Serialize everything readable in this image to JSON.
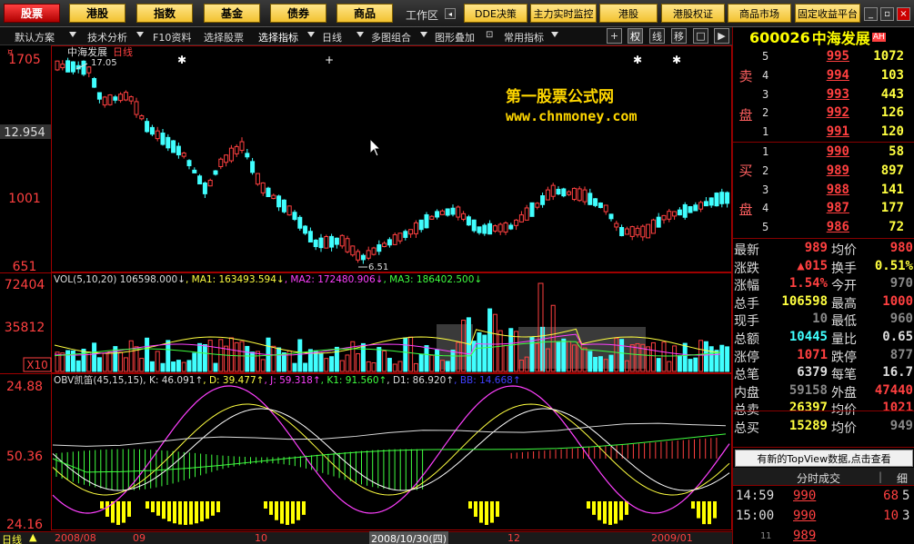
{
  "topbar": {
    "buttons": [
      "股票",
      "港股",
      "指数",
      "基金",
      "债券",
      "商品"
    ],
    "workzone": "工作区",
    "tabs": [
      "DDE决策",
      "主力实时监控",
      "港股",
      "港股权证",
      "商品市场",
      "固定收益平台"
    ]
  },
  "toolbar": {
    "items": [
      "默认方案",
      "技术分析",
      "F10资料",
      "选择股票",
      "选择指标",
      "日线",
      "多图组合",
      "图形叠加",
      "常用指标"
    ],
    "icons": [
      "+",
      "权",
      "线",
      "移",
      "□",
      "▶"
    ]
  },
  "stock": {
    "code": "600026",
    "name": "中海发展",
    "tag": "AH"
  },
  "watermark": {
    "line1": "第一股票公式网",
    "line2": "www.chnmoney.com"
  },
  "main_panel": {
    "title_name": "中海发展",
    "title_period": "日线",
    "price_labels": [
      "1705",
      "12.954",
      "1001",
      "651"
    ],
    "high_note": "17.05",
    "low_note": "6.51"
  },
  "vol_panel": {
    "header": [
      {
        "t": "VOL(5,10,20) 106598.000↓",
        "c": "#ddd"
      },
      {
        "t": "MA1: 163493.594↓",
        "c": "#ffff40"
      },
      {
        "t": "MA2: 172480.906↓",
        "c": "#ff40ff"
      },
      {
        "t": "MA3: 186402.500↓",
        "c": "#40ff40"
      }
    ],
    "labels": [
      "72404",
      "35812",
      "X10"
    ]
  },
  "ind_panel": {
    "header": [
      {
        "t": "OBV凯笛(45,15,15)",
        "c": "#ddd"
      },
      {
        "t": "K: 46.091↑",
        "c": "#ddd"
      },
      {
        "t": "D: 39.477↑",
        "c": "#ffff40"
      },
      {
        "t": "J: 59.318↑",
        "c": "#ff40ff"
      },
      {
        "t": "K1: 91.560↑",
        "c": "#40ff40"
      },
      {
        "t": "D1: 86.920↑",
        "c": "#ddd"
      },
      {
        "t": "BB: 14.668↑",
        "c": "#4040ff"
      }
    ],
    "labels": [
      "24.88",
      "50.36",
      "24.16"
    ]
  },
  "date_axis": {
    "labels": [
      "2008/08",
      "09",
      "10",
      "2008/10/30(四)",
      "12",
      "2009/01"
    ]
  },
  "bottom": {
    "period": "日线"
  },
  "orderbook": {
    "sell_label": [
      "卖",
      "盘"
    ],
    "buy_label": [
      "买",
      "盘"
    ],
    "sell": [
      {
        "lv": "5",
        "px": "995",
        "vol": "1072"
      },
      {
        "lv": "4",
        "px": "994",
        "vol": "103"
      },
      {
        "lv": "3",
        "px": "993",
        "vol": "443"
      },
      {
        "lv": "2",
        "px": "992",
        "vol": "126"
      },
      {
        "lv": "1",
        "px": "991",
        "vol": "120"
      }
    ],
    "buy": [
      {
        "lv": "1",
        "px": "990",
        "vol": "58"
      },
      {
        "lv": "2",
        "px": "989",
        "vol": "897"
      },
      {
        "lv": "3",
        "px": "988",
        "vol": "141"
      },
      {
        "lv": "4",
        "px": "987",
        "vol": "177"
      },
      {
        "lv": "5",
        "px": "986",
        "vol": "72"
      }
    ]
  },
  "stats": [
    {
      "k1": "最新",
      "v1": "989",
      "c1": "c-red",
      "k2": "均价",
      "v2": "980",
      "c2": "c-red"
    },
    {
      "k1": "涨跌",
      "v1": "▲015",
      "c1": "c-red",
      "k2": "换手",
      "v2": "0.51%",
      "c2": "c-yel"
    },
    {
      "k1": "涨幅",
      "v1": "1.54%",
      "c1": "c-red",
      "k2": "今开",
      "v2": "970",
      "c2": "c-gray"
    },
    {
      "k1": "总手",
      "v1": "106598",
      "c1": "c-yel",
      "k2": "最高",
      "v2": "1000",
      "c2": "c-red"
    },
    {
      "k1": "现手",
      "v1": "10",
      "c1": "c-gray",
      "k2": "最低",
      "v2": "960",
      "c2": "c-gray"
    },
    {
      "k1": "总额",
      "v1": "10445",
      "c1": "c-cy",
      "k2": "量比",
      "v2": "0.65",
      "c2": "c-wh"
    },
    {
      "k1": "涨停",
      "v1": "1071",
      "c1": "c-red",
      "k2": "跌停",
      "v2": "877",
      "c2": "c-gray"
    },
    {
      "k1": "总笔",
      "v1": "6379",
      "c1": "c-wh",
      "k2": "每笔",
      "v2": "16.7",
      "c2": "c-wh"
    },
    {
      "k1": "内盘",
      "v1": "59158",
      "c1": "c-gray",
      "k2": "外盘",
      "v2": "47440",
      "c2": "c-red"
    },
    {
      "k1": "总卖",
      "v1": "26397",
      "c1": "c-yel",
      "k2": "均价",
      "v2": "1021",
      "c2": "c-red"
    },
    {
      "k1": "总买",
      "v1": "15289",
      "c1": "c-yel",
      "k2": "均价",
      "v2": "949",
      "c2": "c-gray"
    }
  ],
  "topview": "有新的TopView数据,点击查看",
  "fenshi": {
    "title": "分时成交",
    "btn": "细"
  },
  "trades": [
    {
      "tm": "14:59",
      "tp": "990",
      "tv": "68",
      "tn": "5"
    },
    {
      "tm": "15:00",
      "tp": "990",
      "tv": "10",
      "tn": "3"
    },
    {
      "tm": "11",
      "tp": "989",
      "tv": "",
      "tn": ""
    }
  ]
}
